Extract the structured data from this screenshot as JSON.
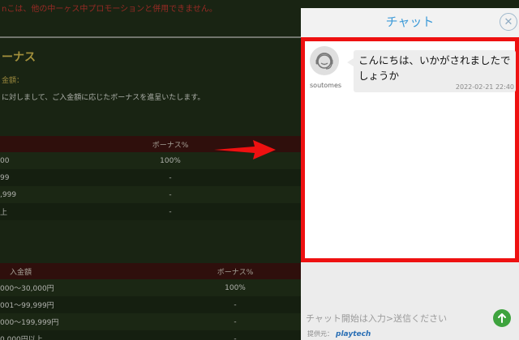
{
  "background": {
    "notice": "nこは、他の中ーヶス中プロモーションと併用できません。",
    "bonus_title": "ーナス",
    "sub_label": "金額：",
    "description": "に対しまして、ご入金額に応じたボーナスを進呈いたします。",
    "table1": {
      "header": [
        "",
        "ボーナス%"
      ],
      "rows": [
        [
          "00",
          "100%"
        ],
        [
          "99",
          "-"
        ],
        [
          ",999",
          "-"
        ],
        [
          "上",
          "-"
        ]
      ]
    },
    "table2": {
      "header": [
        "入金額",
        "ボーナス%"
      ],
      "rows": [
        [
          "000〜30,000円",
          "100%"
        ],
        [
          "001〜99,999円",
          "-"
        ],
        [
          "000〜199,999円",
          "-"
        ],
        [
          "0,000円以上",
          "-"
        ]
      ]
    }
  },
  "chat": {
    "title": "チャット",
    "close_glyph": "✕",
    "message": {
      "sender": "soutomes",
      "text": "こんにちは、いかがされましたでしょうか",
      "timestamp": "2022-02-21 22:40"
    },
    "input_placeholder": "チャット開始は入力>送信ください",
    "provider_label": "提供元：",
    "provider_name": "playtech"
  },
  "colors": {
    "accent_blue": "#3c9ad8",
    "highlight_red": "#ee1111",
    "send_green": "#3ea33e",
    "table_header": "#3a130f"
  },
  "icons": {
    "avatar": "headset-agent-icon",
    "close": "close-circle-icon",
    "send": "up-arrow-icon",
    "annotation": "red-arrow-icon"
  }
}
